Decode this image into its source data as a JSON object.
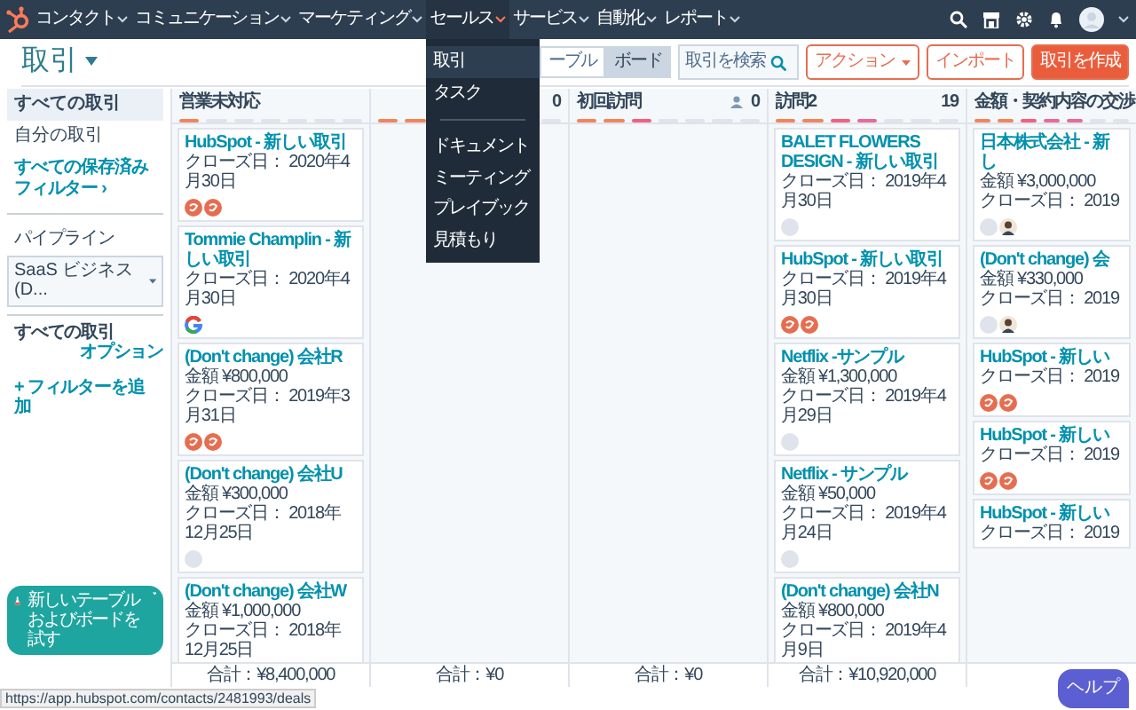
{
  "nav": {
    "items": [
      {
        "label": "コンタクト",
        "selected": false
      },
      {
        "label": "コミュニケーション",
        "selected": false
      },
      {
        "label": "マーケティング",
        "selected": false
      },
      {
        "label": "セールス",
        "selected": true
      },
      {
        "label": "サービス",
        "selected": false
      },
      {
        "label": "自動化",
        "selected": false
      },
      {
        "label": "レポート",
        "selected": false
      }
    ]
  },
  "sales_menu": {
    "items": [
      {
        "label": "取引",
        "selected": true,
        "divider_after": false
      },
      {
        "label": "タスク",
        "selected": false,
        "divider_after": true
      },
      {
        "label": "ドキュメント",
        "selected": false,
        "divider_after": false
      },
      {
        "label": "ミーティング",
        "selected": false,
        "divider_after": false
      },
      {
        "label": "プレイブック",
        "selected": false,
        "divider_after": false
      },
      {
        "label": "見積もり",
        "selected": false,
        "divider_after": false
      }
    ]
  },
  "page": {
    "title": "取引"
  },
  "view_toggle": [
    {
      "label": "ーブル",
      "selected": false
    },
    {
      "label": "ボード",
      "selected": true
    }
  ],
  "search": {
    "placeholder": "取引を検索"
  },
  "buttons": [
    {
      "label": "アクション",
      "kind": "menu"
    },
    {
      "label": "インポート",
      "kind": "outline"
    },
    {
      "label": "取引を作成",
      "kind": "primary"
    }
  ],
  "sidebar": {
    "views": [
      {
        "label": "すべての取引",
        "selected": true
      },
      {
        "label": "自分の取引",
        "selected": false
      }
    ],
    "saved_filters_link": "すべての保存済みフィルター ›",
    "pipeline_label": "パイプライン",
    "pipeline_select": "SaaS ビジネス (D...",
    "filter_title": "すべての取引",
    "options_link": "オプション",
    "add_filter_link": "+ フィルターを追加"
  },
  "columns": [
    {
      "name": "営業未対応",
      "level": 0.14,
      "has_owner_filter": false,
      "total": "合計：¥8,400,000",
      "cards": [
        {
          "title": "HubSpot - 新しい取引",
          "close_date": "クローズ日： 2020年4月30日",
          "avatars": [
            {
              "kind": "initials"
            },
            {
              "kind": "initials"
            }
          ]
        },
        {
          "title": "Tommie Champlin - 新しい取引",
          "close_date": "クローズ日： 2020年4月30日",
          "avatars": [
            {
              "kind": "google"
            }
          ]
        },
        {
          "title": "(Don't change) 会社R",
          "amount": "金額 ¥800,000",
          "close_date": "クローズ日： 2019年3月31日",
          "avatars": [
            {
              "kind": "initials"
            },
            {
              "kind": "initials"
            }
          ]
        },
        {
          "title": "(Don't change) 会社U",
          "amount": "金額 ¥300,000",
          "close_date": "クローズ日： 2018年12月25日",
          "avatars": [
            {
              "kind": "blank"
            }
          ]
        },
        {
          "title": "(Don't change) 会社W",
          "amount": "金額 ¥1,000,000",
          "close_date": "クローズ日： 2018年12月25日"
        }
      ]
    },
    {
      "count": "0",
      "level": 0.29,
      "has_owner_filter": false,
      "total": "合計：¥0"
    },
    {
      "name": "初回訪問",
      "count": "0",
      "level": 0.43,
      "has_owner_filter": true,
      "total": "合計：¥0"
    },
    {
      "name": "訪問2",
      "count": "19",
      "level": 0.57,
      "has_owner_filter": false,
      "total": "合計：¥10,920,000",
      "cards": [
        {
          "title": "BALET FLOWERS DESIGN - 新しい取引",
          "close_date": "クローズ日： 2019年4月30日",
          "avatars": [
            {
              "kind": "blank"
            }
          ]
        },
        {
          "title": "HubSpot - 新しい取引",
          "close_date": "クローズ日： 2019年4月30日",
          "avatars": [
            {
              "kind": "initials"
            },
            {
              "kind": "initials"
            }
          ]
        },
        {
          "title": "Netflix -サンプル",
          "amount": "金額 ¥1,300,000",
          "close_date": "クローズ日： 2019年4月29日",
          "avatars": [
            {
              "kind": "blank"
            }
          ]
        },
        {
          "title": "Netflix - サンプル",
          "amount": "金額 ¥50,000",
          "close_date": "クローズ日： 2019年4月24日",
          "avatars": [
            {
              "kind": "blank"
            }
          ]
        },
        {
          "title": "(Don't change) 会社N",
          "amount": "金額 ¥800,000",
          "close_date": "クローズ日： 2019年4月9日"
        }
      ]
    },
    {
      "name": "金額・契約内容の交渉",
      "level": 0.71,
      "has_owner_filter": false,
      "cards": [
        {
          "title": "日本株式会社 - 新し",
          "amount": "金額 ¥3,000,000",
          "close_date": "クローズ日： 2019",
          "avatars": [
            {
              "kind": "blank"
            },
            {
              "kind": "person"
            }
          ]
        },
        {
          "title": "(Don't change) 会",
          "amount": "金額 ¥330,000",
          "close_date": "クローズ日： 2019",
          "avatars": [
            {
              "kind": "blank"
            },
            {
              "kind": "person"
            }
          ]
        },
        {
          "title": "HubSpot - 新しい",
          "close_date": "クローズ日： 2019",
          "avatars": [
            {
              "kind": "initials"
            },
            {
              "kind": "initials"
            }
          ]
        },
        {
          "title": "HubSpot - 新しい",
          "close_date": "クローズ日： 2019",
          "avatars": [
            {
              "kind": "initials"
            },
            {
              "kind": "initials"
            }
          ]
        },
        {
          "title": "HubSpot - 新しい",
          "close_date": "クローズ日： 2019"
        }
      ]
    }
  ],
  "try_new_button": "新しいテーブルおよびボードを試す",
  "status_url": "https://app.hubspot.com/contacts/2481993/deals",
  "help_button": "ヘルプ"
}
